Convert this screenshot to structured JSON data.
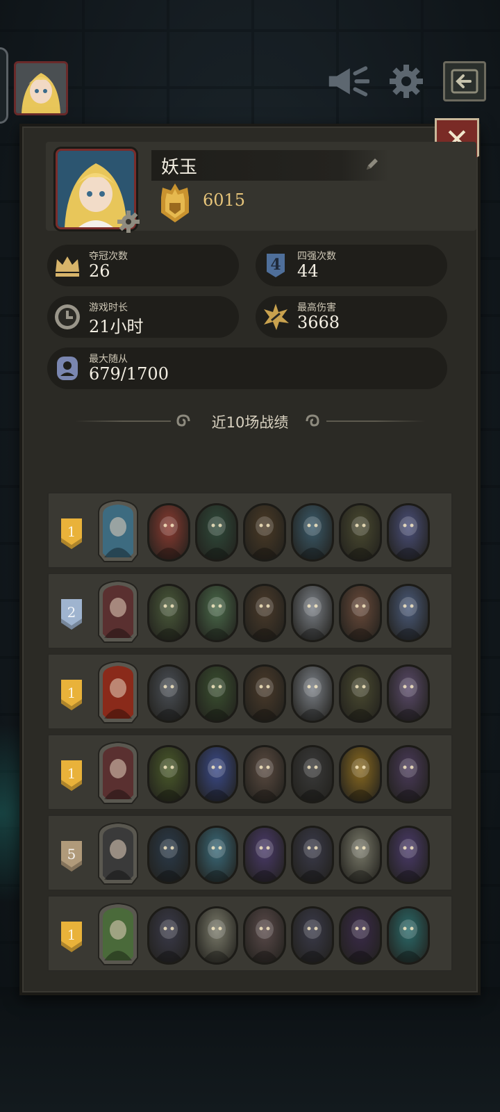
{
  "player": {
    "name": "妖玉",
    "score": "6015"
  },
  "stats": [
    {
      "id": "championships",
      "label": "夺冠次数",
      "value": "26",
      "icon": "crown-icon"
    },
    {
      "id": "top4",
      "label": "四强次数",
      "value": "44",
      "icon": "top4-badge-icon"
    },
    {
      "id": "playtime",
      "label": "游戏时长",
      "value": "21小时",
      "icon": "clock-icon"
    },
    {
      "id": "max_damage",
      "label": "最高伤害",
      "value": "3668",
      "icon": "burst-icon"
    },
    {
      "id": "max_followers",
      "label": "最大随从",
      "value": "679/1700",
      "icon": "follower-icon"
    }
  ],
  "top4_badge_number": "4",
  "section_title": "近10场战绩",
  "matches": [
    {
      "rank": "1",
      "rank_color": "#e9b23a",
      "hero_color": "#3d6b80",
      "units": [
        "#8a3a30",
        "#2f4a3a",
        "#4a3a26",
        "#3a5a6a",
        "#4a4a30",
        "#4a4f7a"
      ]
    },
    {
      "rank": "2",
      "rank_color": "#9fb4cf",
      "hero_color": "#5a3030",
      "units": [
        "#4a5a3a",
        "#4a6a4a",
        "#4a3a2a",
        "#7a7f86",
        "#6a4a3a",
        "#4a5a7a"
      ]
    },
    {
      "rank": "1",
      "rank_color": "#e9b23a",
      "hero_color": "#8a2a1a",
      "units": [
        "#4a4f56",
        "#3a5030",
        "#4a3a2a",
        "#7a7f86",
        "#4a4a30",
        "#5a4a6a"
      ]
    },
    {
      "rank": "1",
      "rank_color": "#e9b23a",
      "hero_color": "#5a3030",
      "units": [
        "#4a5a2a",
        "#3a4a8a",
        "#5a4a40",
        "#3a3a3a",
        "#8a6a20",
        "#4a3a5a"
      ]
    },
    {
      "rank": "5",
      "rank_color": "#b09a7a",
      "hero_color": "#3a3a3a",
      "units": [
        "#2a3a4a",
        "#3a6a7a",
        "#4a3a6a",
        "#3a3a4a",
        "#7a7a6a",
        "#4a3a6a"
      ]
    },
    {
      "rank": "1",
      "rank_color": "#e9b23a",
      "hero_color": "#4a6a3a",
      "units": [
        "#3a3a4a",
        "#7a7a6a",
        "#5a4a4a",
        "#3a3a4a",
        "#3a2a4a",
        "#2a6a6a"
      ]
    }
  ],
  "colors": {
    "accent_gold": "#e6c47a",
    "close_red": "#7a2b26"
  }
}
